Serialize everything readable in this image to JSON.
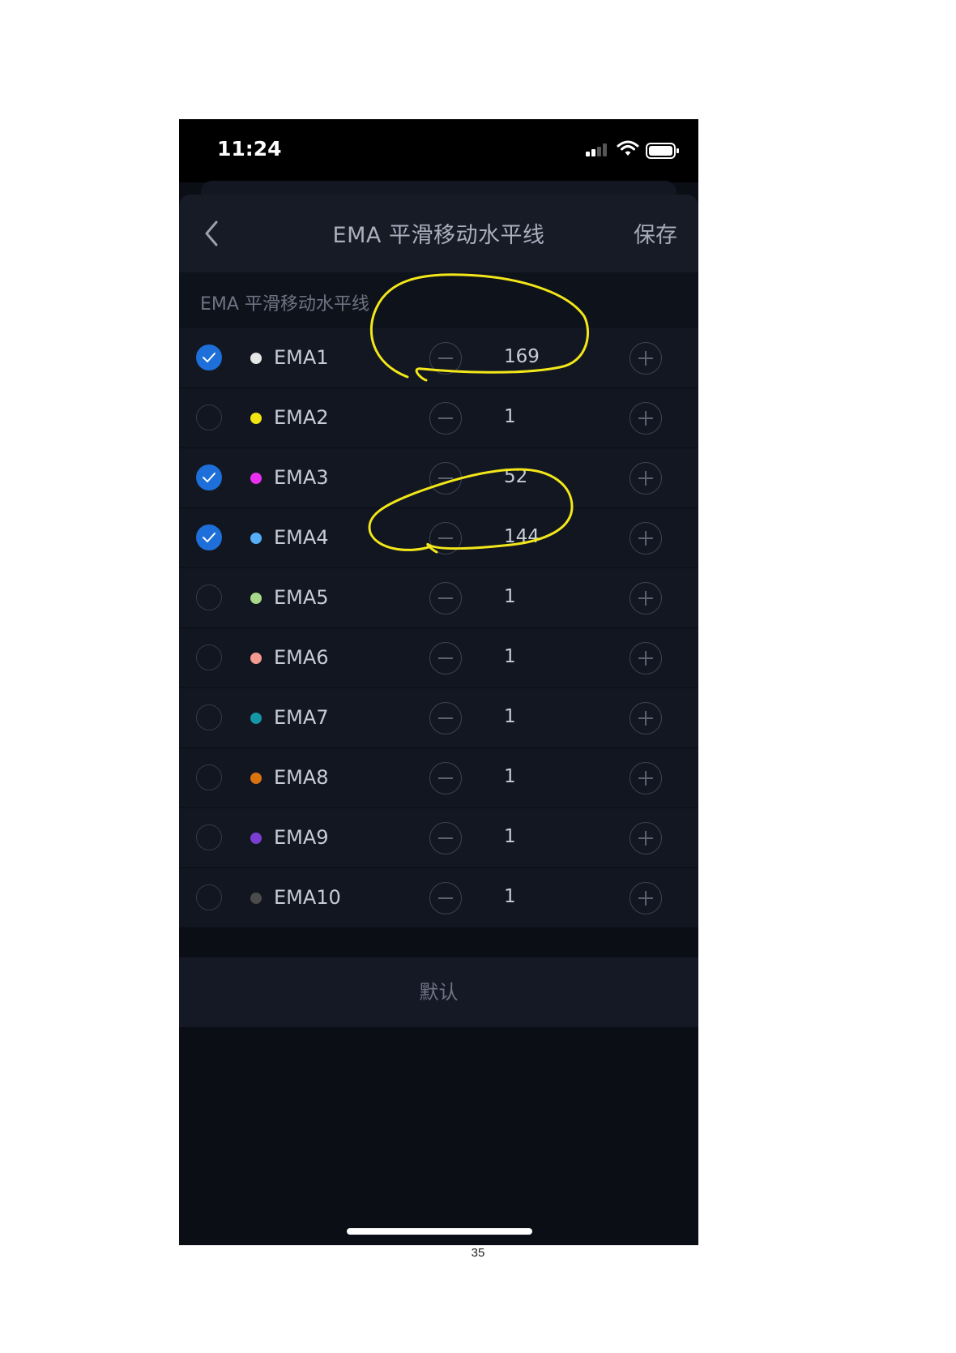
{
  "status_bar": {
    "time": "11:24",
    "signal_icon": "cellular-signal-icon",
    "wifi_icon": "wifi-icon",
    "battery_icon": "battery-icon"
  },
  "nav": {
    "back_icon": "chevron-left-icon",
    "title": "EMA 平滑移动水平线",
    "save_label": "保存"
  },
  "section": {
    "title": "EMA 平滑移动水平线"
  },
  "ema_items": [
    {
      "name": "EMA1",
      "value": "169",
      "checked": true,
      "color": "#e6e6e6"
    },
    {
      "name": "EMA2",
      "value": "1",
      "checked": false,
      "color": "#f2e313"
    },
    {
      "name": "EMA3",
      "value": "52",
      "checked": true,
      "color": "#ea2ff0"
    },
    {
      "name": "EMA4",
      "value": "144",
      "checked": true,
      "color": "#55aef6"
    },
    {
      "name": "EMA5",
      "value": "1",
      "checked": false,
      "color": "#a8d98a"
    },
    {
      "name": "EMA6",
      "value": "1",
      "checked": false,
      "color": "#f49a92"
    },
    {
      "name": "EMA7",
      "value": "1",
      "checked": false,
      "color": "#1596a6"
    },
    {
      "name": "EMA8",
      "value": "1",
      "checked": false,
      "color": "#d9730f"
    },
    {
      "name": "EMA9",
      "value": "1",
      "checked": false,
      "color": "#7a3fd1"
    },
    {
      "name": "EMA10",
      "value": "1",
      "checked": false,
      "color": "#4b4b4b"
    }
  ],
  "default_label": "默认",
  "page_number": "35",
  "colors": {
    "background": "#0b0e15",
    "accent": "#1e6fd9",
    "annotation": "#f3e719"
  }
}
